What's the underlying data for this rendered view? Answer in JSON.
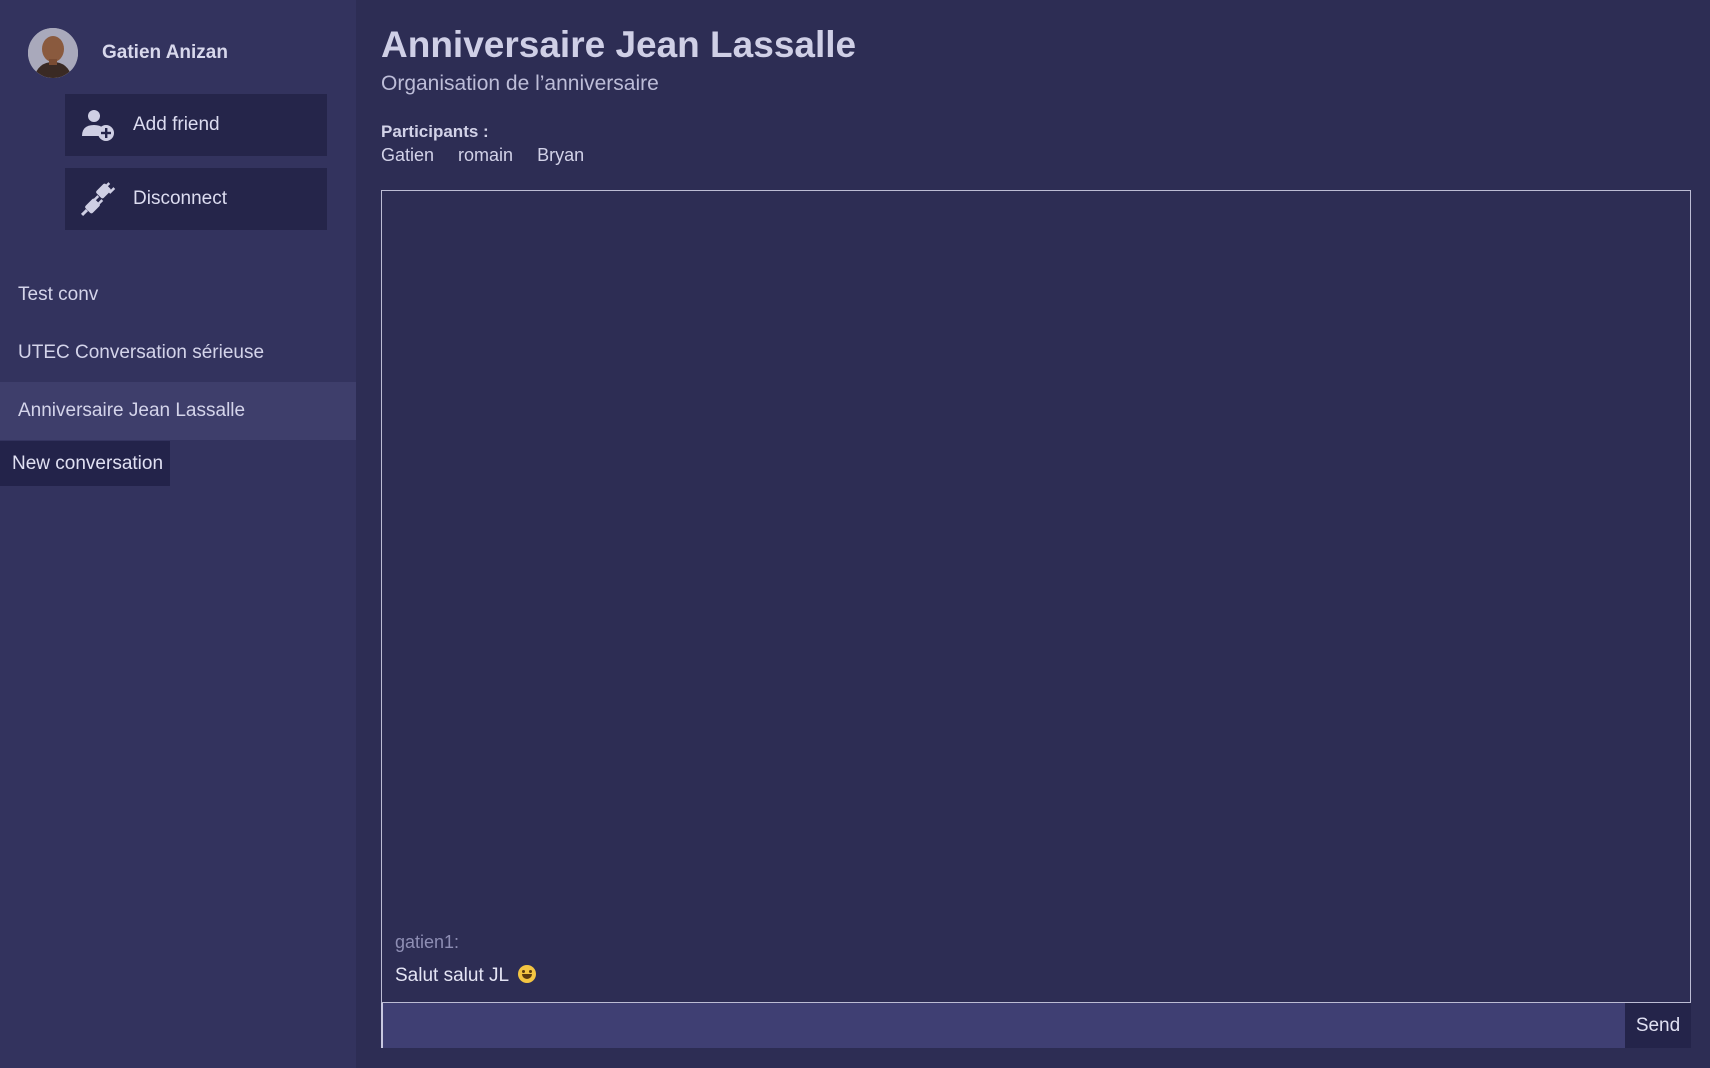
{
  "user": {
    "name": "Gatien Anizan"
  },
  "sidebar": {
    "add_friend_label": "Add friend",
    "disconnect_label": "Disconnect",
    "conversations": [
      {
        "label": "Test conv",
        "active": false
      },
      {
        "label": "UTEC Conversation sérieuse",
        "active": false
      },
      {
        "label": "Anniversaire Jean Lassalle",
        "active": true
      }
    ],
    "new_conversation_label": "New conversation"
  },
  "conversation": {
    "title": "Anniversaire Jean Lassalle",
    "subtitle": "Organisation de l’anniversaire",
    "participants_label": "Participants :",
    "participants": [
      "Gatien",
      "romain",
      "Bryan"
    ],
    "messages": [
      {
        "author": "gatien1:",
        "text": "Salut salut JL",
        "emoji": "grinning-sweat-emoji"
      }
    ]
  },
  "composer": {
    "value": "",
    "placeholder": "",
    "send_label": "Send"
  },
  "icons": {
    "add_friend": "add-user-icon",
    "disconnect": "unplug-icon"
  },
  "colors": {
    "background": "#2d2d54",
    "sidebar": "#33335e",
    "button": "#25254a",
    "active_item": "#3e3e6b",
    "input": "#3f3f73"
  }
}
